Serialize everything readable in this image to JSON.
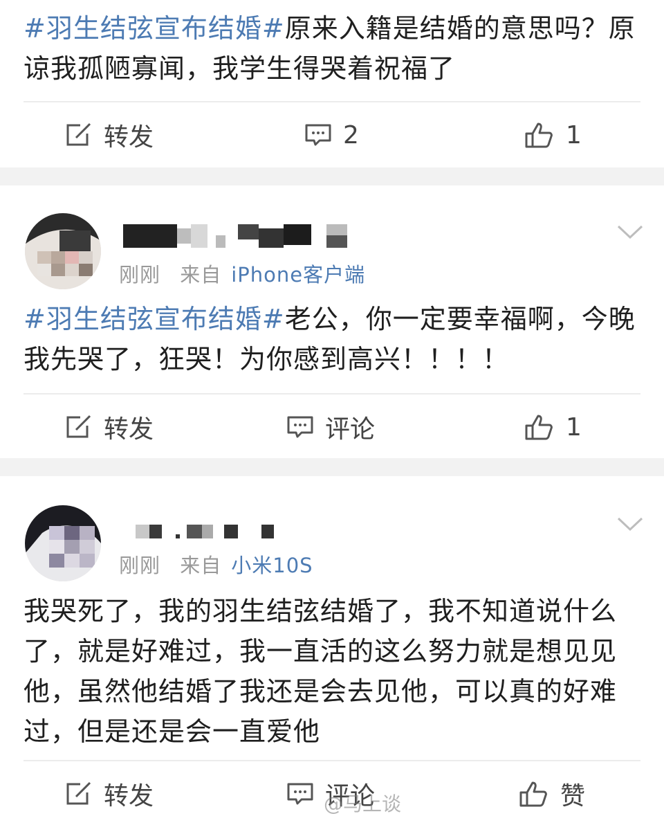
{
  "posts": [
    {
      "hashtag": "#羽生结弦宣布结婚#",
      "line1_rest": "原来入籍是结婚的意思吗？原",
      "line2": "谅我孤陋寡闻，我学生得哭着祝福了",
      "actions": {
        "repost": "转发",
        "comment": "2",
        "like": "1"
      }
    },
    {
      "time": "刚刚",
      "from": "来自",
      "source": "iPhone客户端",
      "hashtag": "#羽生结弦宣布结婚#",
      "line1_rest": "老公，你一定要幸福啊，今晚",
      "line2": "我先哭了，狂哭！为你感到高兴！！！！",
      "actions": {
        "repost": "转发",
        "comment": "评论",
        "like": "1"
      }
    },
    {
      "time": "刚刚",
      "from": "来自",
      "source": "小米10S",
      "lines": [
        "我哭死了，我的羽生结弦结婚了，我不知道说什么",
        "了，就是好难过，我一直活的这么努力就是想见见",
        "他，虽然他结婚了我还是会去见他，可以真的好难",
        "过，但是还是会一直爱他"
      ],
      "actions": {
        "repost": "转发",
        "comment": "评论",
        "like": "赞"
      }
    }
  ],
  "watermark": "@马上谈",
  "icons": {
    "repost": "repost-icon",
    "comment": "comment-icon",
    "like": "like-icon",
    "more": "chevron-down-icon"
  },
  "colors": {
    "link": "#4d7bb3",
    "meta": "#999999",
    "separator": "#f2f2f2"
  }
}
